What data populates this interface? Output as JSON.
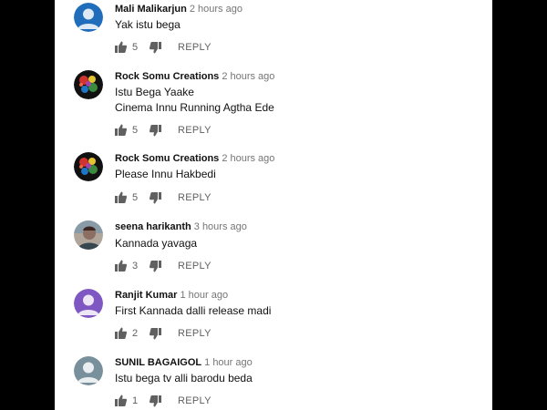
{
  "colors": {
    "page_background": "#000000",
    "panel_background": "#ffffff",
    "author_text": "#111111",
    "meta_text": "#757575",
    "action_text": "#606060"
  },
  "comments": [
    {
      "author": "Mali Malikarjun",
      "time": "2 hours ago",
      "lines": [
        "Yak istu bega"
      ],
      "likes": "5",
      "reply_label": "REPLY",
      "avatar": "person-icon",
      "avatar_color": "#1f6dbb"
    },
    {
      "author": "Rock Somu Creations",
      "time": "2 hours ago",
      "lines": [
        "Istu Bega Yaake",
        "Cinema Innu Running Agtha Ede"
      ],
      "likes": "5",
      "reply_label": "REPLY",
      "avatar": "colorful-splash-image",
      "avatar_color": "#111111"
    },
    {
      "author": "Rock Somu Creations",
      "time": "2 hours ago",
      "lines": [
        "Please Innu Hakbedi"
      ],
      "likes": "5",
      "reply_label": "REPLY",
      "avatar": "colorful-splash-image",
      "avatar_color": "#111111"
    },
    {
      "author": "seena harikanth",
      "time": "3 hours ago",
      "lines": [
        "Kannada yavaga"
      ],
      "likes": "3",
      "reply_label": "REPLY",
      "avatar": "photo-portrait",
      "avatar_color": "#8d6e63"
    },
    {
      "author": "Ranjit Kumar",
      "time": "1 hour ago",
      "lines": [
        "First Kannada dalli release madi"
      ],
      "likes": "2",
      "reply_label": "REPLY",
      "avatar": "person-icon",
      "avatar_color": "#7e57c2"
    },
    {
      "author": "SUNIL BAGAIGOL",
      "time": "1 hour ago",
      "lines": [
        "Istu bega tv alli barodu beda"
      ],
      "likes": "1",
      "reply_label": "REPLY",
      "avatar": "person-icon",
      "avatar_color": "#78909c"
    }
  ]
}
